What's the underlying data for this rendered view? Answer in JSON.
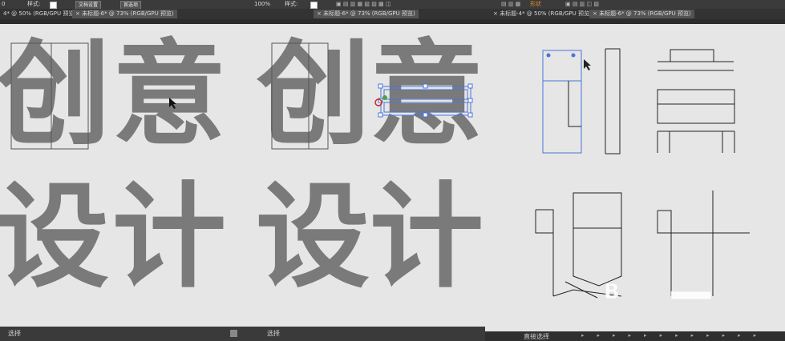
{
  "panel1": {
    "toolbar": {
      "zoom_fragment": "0",
      "style_label": "样式:",
      "doc_setup_button": "文档设置",
      "prefs_button": "首选项"
    },
    "tabs": [
      {
        "label": "4* @ 50% (RGB/GPU 预览)",
        "active": false
      },
      {
        "label": "×  未标题-6* @ 73% (RGB/GPU 预览)",
        "active": true
      }
    ],
    "glyphs": {
      "row1": [
        "创",
        "意"
      ],
      "row2": [
        "设",
        "计"
      ]
    },
    "status": "选择"
  },
  "panel2": {
    "toolbar": {
      "zoom": "100%",
      "style_label": "样式:"
    },
    "tabs": [
      {
        "label": "×  未标题-6* @ 73% (RGB/GPU 预览)",
        "active": true
      }
    ],
    "glyphs": {
      "row1": [
        "创",
        "意"
      ],
      "row2": [
        "设",
        "计"
      ]
    },
    "status": "选择"
  },
  "panel3": {
    "toolbar": {
      "menu_label": "形状"
    },
    "tabs": [
      {
        "label": "×  未标题-4* @ 50% (RGB/GPU 预览)",
        "active": false
      },
      {
        "label": "×  未标题-6* @ 73% (RGB/GPU 预览)",
        "active": true
      }
    ],
    "status": "直接选择"
  },
  "colors": {
    "ghost_glyph": "#7a7a7a",
    "selection": "#4a74d9",
    "canvas": "#e6e6e6",
    "chrome": "#3a3a3a"
  },
  "icons": [
    "cursor-arrow-icon",
    "close-tab-icon",
    "watermark-logo-icon"
  ]
}
